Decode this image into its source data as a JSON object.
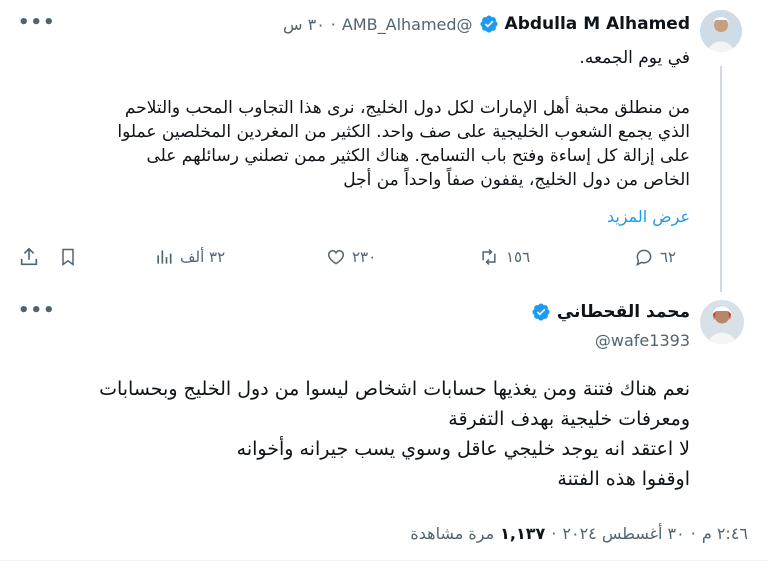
{
  "colors": {
    "accent": "#1d9bf0",
    "muted": "#536471",
    "text": "#0f1419",
    "verified": "#1d9bf0"
  },
  "parent": {
    "author_name": "Abdulla M Alhamed",
    "handle": "@AMB_Alhamed",
    "separator": "·",
    "time": "٣٠ س",
    "first_line": "في يوم الجمعه.",
    "body_lines": [
      "من منطلق محبة أهل الإمارات لكل دول الخليج، نرى هذا التجاوب المحب والتلاحم",
      "الذي يجمع الشعوب الخليجية على صف واحد. الكثير من المغردين المخلصين عملوا",
      "على إزالة كل إساءة وفتح باب التسامح. هناك الكثير ممن تصلني رسائلهم على",
      "الخاص من دول الخليج، يقفون صفاً واحداً من أجل"
    ],
    "show_more": "عرض المزيد",
    "replies": "٦٢",
    "retweets": "١٥٦",
    "likes": "٢٣٠",
    "views": "٣٢ ألف",
    "more_icon": "more-horizontal-icon"
  },
  "reply": {
    "author_name": "محمد القحطاني",
    "handle": "@wafe1393",
    "lines": [
      "نعم هناك فتنة ومن يغذيها حسابات اشخاص ليسوا من دول الخليج وبحسابات",
      "ومعرفات خليجية بهدف التفرقة",
      "لا اعتقد انه يوجد خليجي عاقل وسوي يسب جيرانه وأخوانه",
      "اوقفوا هذه الفتنة"
    ],
    "time": "٢:٤٦ م",
    "date": "٣٠ أغسطس ٢٠٢٤",
    "separator": "·",
    "views_count": "١,١٣٧",
    "views_label": "مرة مشاهدة"
  }
}
